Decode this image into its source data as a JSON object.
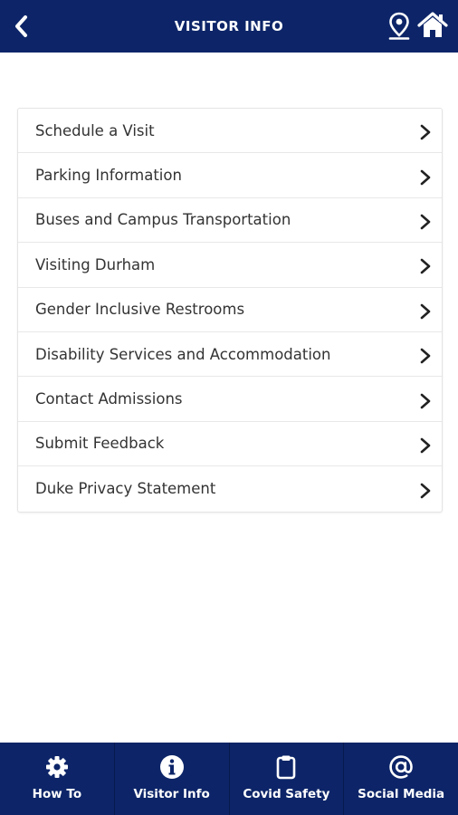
{
  "header": {
    "title": "VISITOR INFO",
    "back_icon": "chevron-left-icon",
    "map_icon": "map-pin-icon",
    "home_icon": "home-icon",
    "background": "#0d2568"
  },
  "menu": {
    "items": [
      {
        "label": "Schedule a Visit"
      },
      {
        "label": "Parking Information"
      },
      {
        "label": "Buses and Campus Transportation"
      },
      {
        "label": "Visiting Durham"
      },
      {
        "label": "Gender Inclusive Restrooms"
      },
      {
        "label": "Disability Services and Accommodation"
      },
      {
        "label": "Contact Admissions"
      },
      {
        "label": "Submit Feedback"
      },
      {
        "label": "Duke Privacy Statement"
      }
    ],
    "chevron_icon": "chevron-right-icon"
  },
  "tabbar": {
    "tabs": [
      {
        "label": "How To",
        "icon": "gear-icon"
      },
      {
        "label": "Visitor Info",
        "icon": "info-icon"
      },
      {
        "label": "Covid Safety",
        "icon": "clipboard-icon"
      },
      {
        "label": "Social Media",
        "icon": "at-sign-icon"
      }
    ],
    "background": "#0d2568"
  }
}
